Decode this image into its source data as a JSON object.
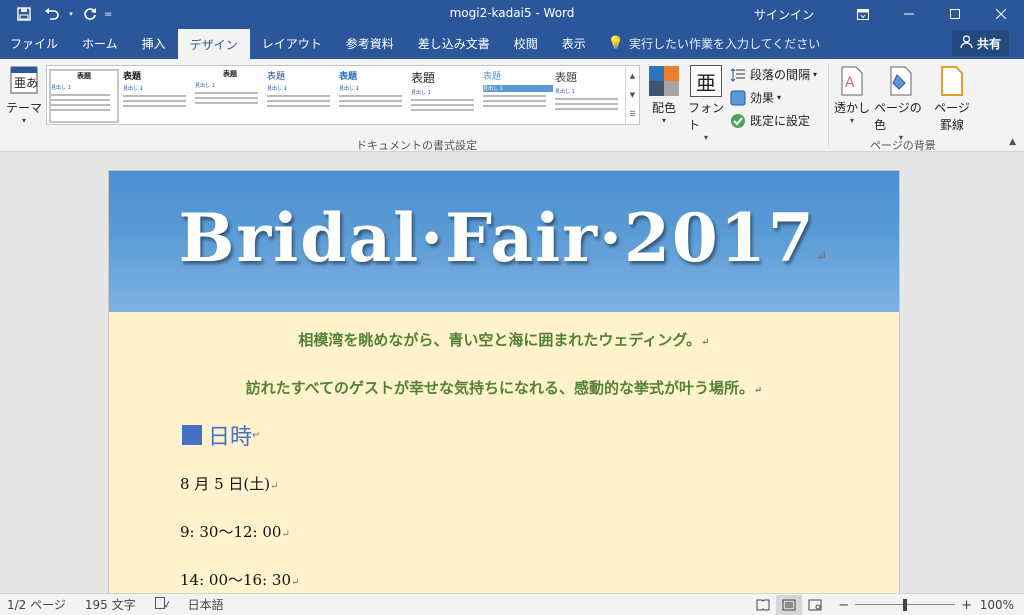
{
  "window": {
    "title": "mogi2-kadai5  -  Word",
    "signin": "サインイン",
    "share": "共有",
    "qat_separator": "=",
    "min_icon": "minimize-icon",
    "restore_icon": "restore-icon",
    "close_icon": "close-icon"
  },
  "tabs": [
    {
      "label": "ファイル"
    },
    {
      "label": "ホーム"
    },
    {
      "label": "挿入"
    },
    {
      "label": "デザイン",
      "active": true
    },
    {
      "label": "レイアウト"
    },
    {
      "label": "参考資料"
    },
    {
      "label": "差し込み文書"
    },
    {
      "label": "校閲"
    },
    {
      "label": "表示"
    }
  ],
  "tell_me": "実行したい作業を入力してください",
  "ribbon": {
    "theme_label": "テーマ",
    "gallery_items": [
      {
        "title": "表題",
        "heading": "見出し 1"
      },
      {
        "title": "表題",
        "heading": "見出し 1"
      },
      {
        "title": "表題",
        "heading": "見出し 1"
      },
      {
        "title": "表題",
        "heading": "見出し 1"
      },
      {
        "title": "表題",
        "heading": "見出し 1"
      },
      {
        "title": "表題",
        "heading": "見出し 1"
      },
      {
        "title": "表題",
        "heading": "見出し 1"
      },
      {
        "title": "表題",
        "heading": "見出し 1"
      }
    ],
    "color_label": "配色",
    "font_label": "フォント",
    "font_glyph": "亜",
    "para_spacing_label": "段落の間隔",
    "effects_label": "効果",
    "set_default_label": "既定に設定",
    "doc_format_group": "ドキュメントの書式設定",
    "watermark_label": "透かし",
    "page_color_label": "ページの色",
    "page_border_label_1": "ページ",
    "page_border_label_2": "罫線",
    "page_bg_group": "ページの背景",
    "accent_colors": [
      "#2e75b6",
      "#ed7d31",
      "#44546a",
      "#a5a5a5"
    ]
  },
  "document": {
    "banner_title": "Bridal·Fair·2017",
    "line1": "相模湾を眺めながら、青い空と海に囲まれたウェディング。",
    "line2": "訪れたすべてのゲストが幸せな気持ちになれる、感動的な挙式が叶う場所。",
    "heading": "日時",
    "date": "8 月 5 日(土)",
    "time1": "9: 30〜12: 00",
    "time2": "14: 00〜16: 30",
    "para_mark": "↵"
  },
  "status": {
    "page": "1/2 ページ",
    "words": "195 文字",
    "language": "日本語",
    "zoom": "100%",
    "zoom_fraction": 0.5
  }
}
